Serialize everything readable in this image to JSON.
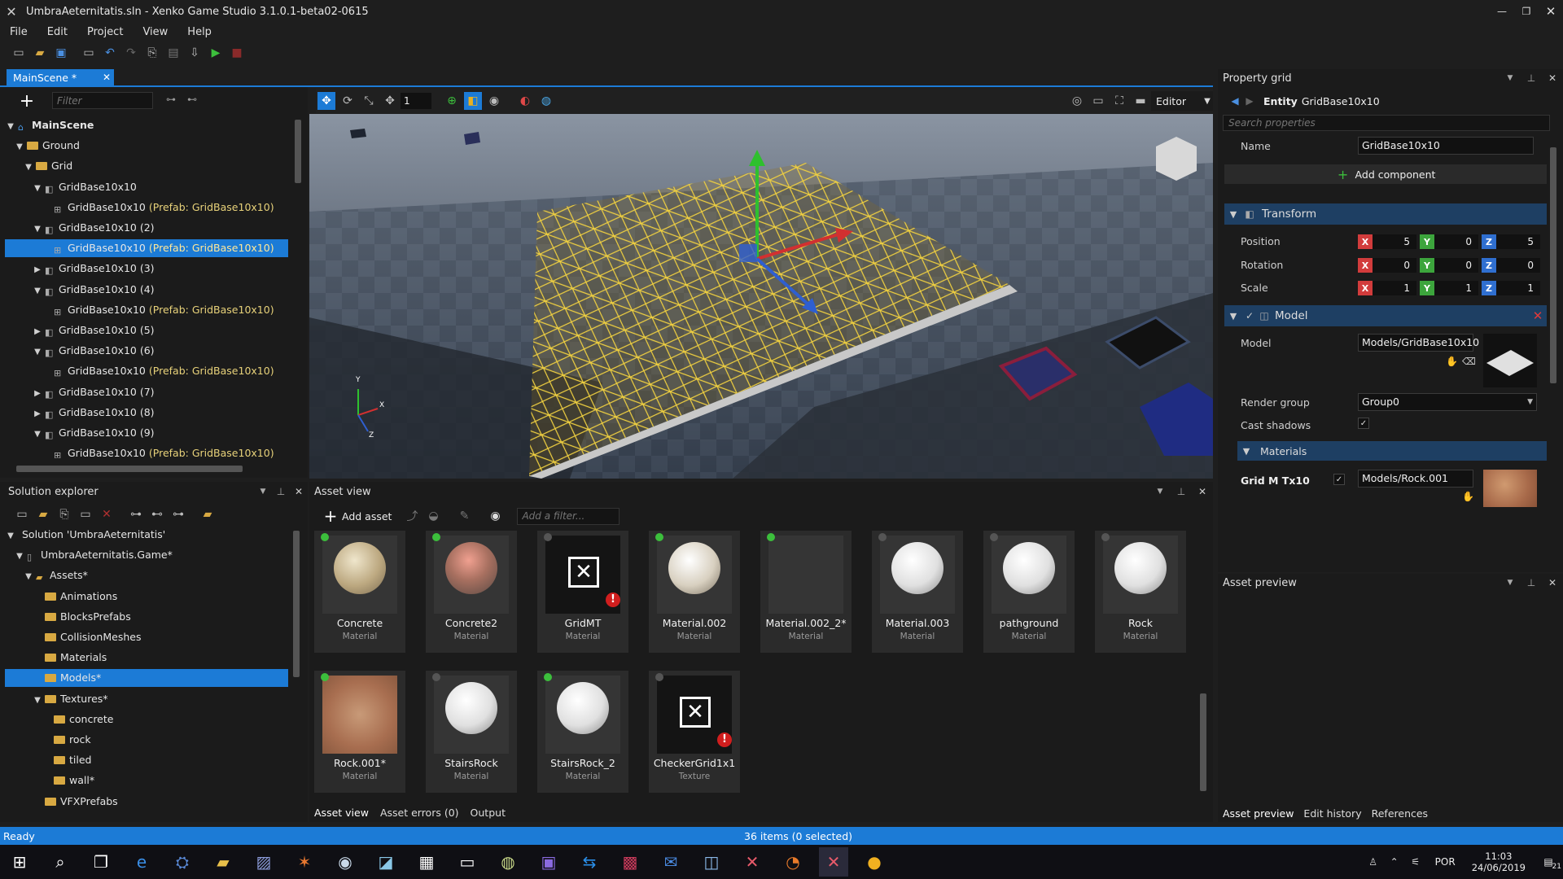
{
  "window": {
    "title": "UmbraAeternitatis.sln - Xenko Game Studio 3.1.0.1-beta02-0615"
  },
  "menu": [
    "File",
    "Edit",
    "Project",
    "View",
    "Help"
  ],
  "scene_tab": {
    "label": "MainScene *"
  },
  "scene_tree": {
    "filter_placeholder": "Filter",
    "items": [
      {
        "label": "MainScene",
        "prefab": ""
      },
      {
        "label": "Ground",
        "prefab": ""
      },
      {
        "label": "Grid",
        "prefab": ""
      },
      {
        "label": "GridBase10x10",
        "prefab": ""
      },
      {
        "label": "GridBase10x10",
        "prefab": "(Prefab: GridBase10x10)"
      },
      {
        "label": "GridBase10x10 (2)",
        "prefab": ""
      },
      {
        "label": "GridBase10x10",
        "prefab": "(Prefab: GridBase10x10)"
      },
      {
        "label": "GridBase10x10 (3)",
        "prefab": ""
      },
      {
        "label": "GridBase10x10 (4)",
        "prefab": ""
      },
      {
        "label": "GridBase10x10",
        "prefab": "(Prefab: GridBase10x10)"
      },
      {
        "label": "GridBase10x10 (5)",
        "prefab": ""
      },
      {
        "label": "GridBase10x10 (6)",
        "prefab": ""
      },
      {
        "label": "GridBase10x10",
        "prefab": "(Prefab: GridBase10x10)"
      },
      {
        "label": "GridBase10x10 (7)",
        "prefab": ""
      },
      {
        "label": "GridBase10x10 (8)",
        "prefab": ""
      },
      {
        "label": "GridBase10x10 (9)",
        "prefab": ""
      },
      {
        "label": "GridBase10x10",
        "prefab": "(Prefab: GridBase10x10)"
      }
    ]
  },
  "viewport": {
    "snap_value": "1",
    "camera_mode": "Editor",
    "gizmo_labels": {
      "x": "X",
      "y": "Y",
      "z": "Z"
    }
  },
  "solution_explorer": {
    "title": "Solution explorer",
    "items": [
      "Solution 'UmbraAeternitatis'",
      "UmbraAeternitatis.Game*",
      "Assets*",
      "Animations",
      "BlocksPrefabs",
      "CollisionMeshes",
      "Materials",
      "Models*",
      "Textures*",
      "concrete",
      "rock",
      "tiled",
      "wall*",
      "VFXPrefabs"
    ]
  },
  "asset_view": {
    "title": "Asset view",
    "add_asset": "Add asset",
    "filter_placeholder": "Add a filter...",
    "assets": [
      {
        "name": "Concrete",
        "type": "Material"
      },
      {
        "name": "Concrete2",
        "type": "Material"
      },
      {
        "name": "GridMT",
        "type": "Material"
      },
      {
        "name": "Material.002",
        "type": "Material"
      },
      {
        "name": "Material.002_2*",
        "type": "Material"
      },
      {
        "name": "Material.003",
        "type": "Material"
      },
      {
        "name": "pathground",
        "type": "Material"
      },
      {
        "name": "Rock",
        "type": "Material"
      },
      {
        "name": "Rock.001*",
        "type": "Material"
      },
      {
        "name": "StairsRock",
        "type": "Material"
      },
      {
        "name": "StairsRock_2",
        "type": "Material"
      },
      {
        "name": "CheckerGrid1x1",
        "type": "Texture"
      }
    ],
    "tabs": [
      "Asset view",
      "Asset errors (0)",
      "Output"
    ]
  },
  "property_grid": {
    "title": "Property grid",
    "entity_prefix": "Entity",
    "entity_name": "GridBase10x10",
    "search_placeholder": "Search properties",
    "name_label": "Name",
    "name_value": "GridBase10x10",
    "add_component": "Add component",
    "transform": {
      "title": "Transform",
      "position_label": "Position",
      "position": [
        "5",
        "0",
        "5"
      ],
      "rotation_label": "Rotation",
      "rotation": [
        "0",
        "0",
        "0"
      ],
      "scale_label": "Scale",
      "scale": [
        "1",
        "1",
        "1"
      ]
    },
    "model": {
      "title": "Model",
      "model_label": "Model",
      "model_value": "Models/GridBase10x10",
      "render_group_label": "Render group",
      "render_group_value": "Group0",
      "cast_shadows_label": "Cast shadows",
      "materials_title": "Materials",
      "material_slot": "Grid M Tx10",
      "material_value": "Models/Rock.001"
    }
  },
  "asset_preview": {
    "title": "Asset preview",
    "tabs": [
      "Asset preview",
      "Edit history",
      "References"
    ]
  },
  "status": {
    "left": "Ready",
    "center": "36 items (0 selected)"
  },
  "taskbar": {
    "lang": "POR",
    "time": "11:03",
    "date": "24/06/2019",
    "notif": "21"
  },
  "colors": {
    "accent": "#1c7bd6",
    "x": "#d23c3c",
    "y": "#3ca53c",
    "z": "#2f6fd0"
  }
}
